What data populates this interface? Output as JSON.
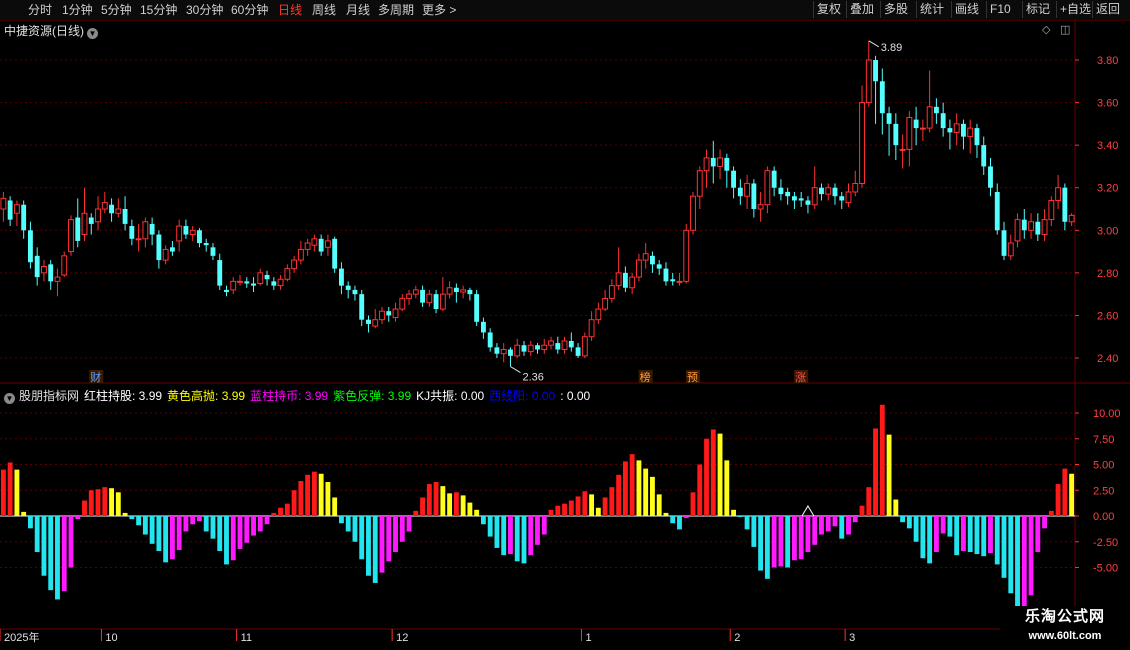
{
  "toolbar": {
    "periods": [
      "分时",
      "1分钟",
      "5分钟",
      "15分钟",
      "30分钟",
      "60分钟",
      "日线",
      "周线",
      "月线",
      "多周期",
      "更多 >"
    ],
    "active_period": "日线",
    "right_buttons": [
      "复权",
      "叠加",
      "多股",
      "统计",
      "画线",
      "F10",
      "标记",
      "+自选",
      "返回"
    ]
  },
  "stock_title": "中捷资源(日线)",
  "indicator": {
    "name": "股朋指标网",
    "items": [
      {
        "label": "红柱持股:",
        "value": "3.99",
        "color": "#ffffff"
      },
      {
        "label": "黄色高抛:",
        "value": "3.99",
        "color": "#ffff00"
      },
      {
        "label": "蓝柱持币:",
        "value": "3.99",
        "color": "#ff00ff"
      },
      {
        "label": "紫色反弹:",
        "value": "3.99",
        "color": "#00ff00"
      },
      {
        "label": "KJ共振:",
        "value": "0.00",
        "color": "#ffffff"
      },
      {
        "label": "西线阳:",
        "value": "0.00",
        "color": "#0000ff"
      },
      {
        "label": ":",
        "value": "0.00",
        "color": "#ffffff"
      }
    ]
  },
  "price_axis": [
    "3.80",
    "3.60",
    "3.40",
    "3.20",
    "3.00",
    "2.80",
    "2.60",
    "2.40"
  ],
  "indicator_axis": [
    "10.00",
    "7.50",
    "5.00",
    "2.50",
    "0.00",
    "-2.50",
    "-5.00"
  ],
  "date_axis": [
    "2025年",
    "10",
    "11",
    "12",
    "1",
    "2",
    "3"
  ],
  "annotations": {
    "high": "3.89",
    "low": "2.36"
  },
  "event_tags": [
    "财",
    "榜",
    "预",
    "涨"
  ],
  "watermark": {
    "title": "乐淘公式网",
    "url": "www.60lt.com"
  },
  "chart_data": {
    "type": "candlestick",
    "candles": [
      [
        3.1,
        3.15,
        3.18,
        3.04
      ],
      [
        3.14,
        3.05,
        3.16,
        3.02
      ],
      [
        3.08,
        3.12,
        3.14,
        3.02
      ],
      [
        3.12,
        3.0,
        3.14,
        2.96
      ],
      [
        3.0,
        2.85,
        3.04,
        2.82
      ],
      [
        2.88,
        2.78,
        2.92,
        2.74
      ],
      [
        2.8,
        2.83,
        2.86,
        2.76
      ],
      [
        2.84,
        2.76,
        2.86,
        2.72
      ],
      [
        2.76,
        2.78,
        2.82,
        2.69
      ],
      [
        2.79,
        2.88,
        2.9,
        2.78
      ],
      [
        2.9,
        3.05,
        3.07,
        2.88
      ],
      [
        3.06,
        2.95,
        3.15,
        2.92
      ],
      [
        2.98,
        3.08,
        3.2,
        2.95
      ],
      [
        3.06,
        3.03,
        3.08,
        2.98
      ],
      [
        3.04,
        3.1,
        3.16,
        3.0
      ],
      [
        3.1,
        3.13,
        3.18,
        3.08
      ],
      [
        3.12,
        3.08,
        3.15,
        3.04
      ],
      [
        3.08,
        3.1,
        3.15,
        3.06
      ],
      [
        3.1,
        3.03,
        3.16,
        3.0
      ],
      [
        3.02,
        2.96,
        3.05,
        2.93
      ],
      [
        2.96,
        2.96,
        3.03,
        2.9
      ],
      [
        2.96,
        3.04,
        3.06,
        2.92
      ],
      [
        3.03,
        2.98,
        3.06,
        2.93
      ],
      [
        2.98,
        2.86,
        3.0,
        2.82
      ],
      [
        2.86,
        2.91,
        2.93,
        2.84
      ],
      [
        2.92,
        2.9,
        2.95,
        2.88
      ],
      [
        2.95,
        3.02,
        3.05,
        2.9
      ],
      [
        3.02,
        2.98,
        3.05,
        2.96
      ],
      [
        2.98,
        3.0,
        3.02,
        2.95
      ],
      [
        3.0,
        2.94,
        3.01,
        2.92
      ],
      [
        2.94,
        2.93,
        2.96,
        2.9
      ],
      [
        2.92,
        2.88,
        2.94,
        2.86
      ],
      [
        2.86,
        2.74,
        2.89,
        2.72
      ],
      [
        2.72,
        2.71,
        2.74,
        2.69
      ],
      [
        2.72,
        2.76,
        2.78,
        2.7
      ],
      [
        2.76,
        2.76,
        2.79,
        2.74
      ],
      [
        2.76,
        2.75,
        2.78,
        2.73
      ],
      [
        2.75,
        2.74,
        2.78,
        2.71
      ],
      [
        2.75,
        2.8,
        2.82,
        2.74
      ],
      [
        2.79,
        2.77,
        2.81,
        2.74
      ],
      [
        2.76,
        2.74,
        2.78,
        2.72
      ],
      [
        2.74,
        2.77,
        2.79,
        2.72
      ],
      [
        2.77,
        2.82,
        2.84,
        2.76
      ],
      [
        2.82,
        2.86,
        2.88,
        2.8
      ],
      [
        2.86,
        2.91,
        2.95,
        2.84
      ],
      [
        2.91,
        2.94,
        2.96,
        2.88
      ],
      [
        2.93,
        2.96,
        2.98,
        2.9
      ],
      [
        2.96,
        2.9,
        2.98,
        2.88
      ],
      [
        2.92,
        2.95,
        2.98,
        2.88
      ],
      [
        2.96,
        2.82,
        2.97,
        2.8
      ],
      [
        2.82,
        2.74,
        2.85,
        2.7
      ],
      [
        2.74,
        2.72,
        2.76,
        2.68
      ],
      [
        2.72,
        2.7,
        2.74,
        2.67
      ],
      [
        2.7,
        2.58,
        2.72,
        2.55
      ],
      [
        2.58,
        2.56,
        2.6,
        2.52
      ],
      [
        2.55,
        2.58,
        2.63,
        2.54
      ],
      [
        2.58,
        2.62,
        2.64,
        2.56
      ],
      [
        2.62,
        2.6,
        2.64,
        2.57
      ],
      [
        2.59,
        2.63,
        2.66,
        2.57
      ],
      [
        2.63,
        2.68,
        2.7,
        2.62
      ],
      [
        2.68,
        2.7,
        2.72,
        2.65
      ],
      [
        2.7,
        2.72,
        2.74,
        2.68
      ],
      [
        2.72,
        2.66,
        2.74,
        2.64
      ],
      [
        2.66,
        2.7,
        2.72,
        2.64
      ],
      [
        2.7,
        2.63,
        2.72,
        2.61
      ],
      [
        2.63,
        2.7,
        2.78,
        2.62
      ],
      [
        2.7,
        2.73,
        2.76,
        2.68
      ],
      [
        2.73,
        2.71,
        2.75,
        2.66
      ],
      [
        2.71,
        2.72,
        2.74,
        2.68
      ],
      [
        2.72,
        2.7,
        2.73,
        2.67
      ],
      [
        2.7,
        2.57,
        2.72,
        2.55
      ],
      [
        2.57,
        2.52,
        2.59,
        2.49
      ],
      [
        2.52,
        2.45,
        2.54,
        2.43
      ],
      [
        2.45,
        2.42,
        2.47,
        2.4
      ],
      [
        2.42,
        2.44,
        2.47,
        2.38
      ],
      [
        2.44,
        2.41,
        2.45,
        2.36
      ],
      [
        2.41,
        2.46,
        2.49,
        2.4
      ],
      [
        2.46,
        2.43,
        2.48,
        2.41
      ],
      [
        2.43,
        2.46,
        2.48,
        2.41
      ],
      [
        2.46,
        2.44,
        2.47,
        2.42
      ],
      [
        2.44,
        2.46,
        2.49,
        2.42
      ],
      [
        2.46,
        2.48,
        2.5,
        2.44
      ],
      [
        2.47,
        2.44,
        2.5,
        2.42
      ],
      [
        2.44,
        2.48,
        2.5,
        2.42
      ],
      [
        2.48,
        2.45,
        2.52,
        2.43
      ],
      [
        2.45,
        2.41,
        2.47,
        2.4
      ],
      [
        2.41,
        2.5,
        2.52,
        2.4
      ],
      [
        2.5,
        2.58,
        2.62,
        2.48
      ],
      [
        2.58,
        2.63,
        2.66,
        2.56
      ],
      [
        2.63,
        2.68,
        2.72,
        2.62
      ],
      [
        2.68,
        2.74,
        2.77,
        2.66
      ],
      [
        2.74,
        2.8,
        2.92,
        2.72
      ],
      [
        2.8,
        2.73,
        2.83,
        2.71
      ],
      [
        2.73,
        2.78,
        2.8,
        2.7
      ],
      [
        2.78,
        2.86,
        2.89,
        2.76
      ],
      [
        2.86,
        2.89,
        2.94,
        2.82
      ],
      [
        2.88,
        2.84,
        2.9,
        2.8
      ],
      [
        2.84,
        2.82,
        2.86,
        2.79
      ],
      [
        2.82,
        2.76,
        2.85,
        2.74
      ],
      [
        2.77,
        2.76,
        2.8,
        2.74
      ],
      [
        2.76,
        2.76,
        2.8,
        2.74
      ],
      [
        2.76,
        3.0,
        3.03,
        2.75
      ],
      [
        3.0,
        3.16,
        3.18,
        2.98
      ],
      [
        3.16,
        3.28,
        3.3,
        3.1
      ],
      [
        3.28,
        3.34,
        3.38,
        3.2
      ],
      [
        3.34,
        3.3,
        3.42,
        3.22
      ],
      [
        3.3,
        3.34,
        3.38,
        3.24
      ],
      [
        3.34,
        3.28,
        3.36,
        3.2
      ],
      [
        3.28,
        3.2,
        3.3,
        3.15
      ],
      [
        3.2,
        3.16,
        3.24,
        3.12
      ],
      [
        3.16,
        3.22,
        3.26,
        3.1
      ],
      [
        3.22,
        3.1,
        3.24,
        3.06
      ],
      [
        3.1,
        3.12,
        3.18,
        3.04
      ],
      [
        3.12,
        3.28,
        3.3,
        3.08
      ],
      [
        3.28,
        3.2,
        3.3,
        3.16
      ],
      [
        3.2,
        3.17,
        3.24,
        3.14
      ],
      [
        3.18,
        3.16,
        3.2,
        3.12
      ],
      [
        3.16,
        3.14,
        3.18,
        3.1
      ],
      [
        3.15,
        3.14,
        3.18,
        3.11
      ],
      [
        3.14,
        3.12,
        3.16,
        3.08
      ],
      [
        3.12,
        3.2,
        3.3,
        3.1
      ],
      [
        3.2,
        3.17,
        3.22,
        3.14
      ],
      [
        3.17,
        3.2,
        3.22,
        3.14
      ],
      [
        3.2,
        3.16,
        3.22,
        3.12
      ],
      [
        3.16,
        3.14,
        3.18,
        3.1
      ],
      [
        3.13,
        3.18,
        3.22,
        3.11
      ],
      [
        3.18,
        3.22,
        3.28,
        3.16
      ],
      [
        3.22,
        3.6,
        3.68,
        3.2
      ],
      [
        3.6,
        3.8,
        3.89,
        3.58
      ],
      [
        3.8,
        3.7,
        3.82,
        3.5
      ],
      [
        3.7,
        3.55,
        3.76,
        3.45
      ],
      [
        3.55,
        3.5,
        3.58,
        3.35
      ],
      [
        3.5,
        3.4,
        3.55,
        3.33
      ],
      [
        3.38,
        3.38,
        3.45,
        3.29
      ],
      [
        3.38,
        3.53,
        3.56,
        3.3
      ],
      [
        3.52,
        3.48,
        3.58,
        3.4
      ],
      [
        3.48,
        3.48,
        3.52,
        3.42
      ],
      [
        3.48,
        3.58,
        3.75,
        3.46
      ],
      [
        3.58,
        3.55,
        3.62,
        3.5
      ],
      [
        3.55,
        3.48,
        3.6,
        3.44
      ],
      [
        3.48,
        3.46,
        3.52,
        3.38
      ],
      [
        3.46,
        3.5,
        3.55,
        3.4
      ],
      [
        3.5,
        3.44,
        3.52,
        3.38
      ],
      [
        3.44,
        3.48,
        3.52,
        3.36
      ],
      [
        3.48,
        3.4,
        3.5,
        3.34
      ],
      [
        3.4,
        3.3,
        3.44,
        3.26
      ],
      [
        3.3,
        3.2,
        3.34,
        3.16
      ],
      [
        3.18,
        3.0,
        3.22,
        2.98
      ],
      [
        3.0,
        2.88,
        3.04,
        2.86
      ],
      [
        2.88,
        2.94,
        2.98,
        2.86
      ],
      [
        2.95,
        3.05,
        3.08,
        2.92
      ],
      [
        3.05,
        3.0,
        3.1,
        2.96
      ],
      [
        3.0,
        3.04,
        3.08,
        2.96
      ],
      [
        3.04,
        2.98,
        3.08,
        2.95
      ],
      [
        2.98,
        3.05,
        3.1,
        2.95
      ],
      [
        3.05,
        3.14,
        3.16,
        3.02
      ],
      [
        3.14,
        3.2,
        3.26,
        3.1
      ],
      [
        3.2,
        3.04,
        3.22,
        3.0
      ],
      [
        3.04,
        3.07,
        3.08,
        3.02
      ]
    ],
    "indicator_values": [
      4.5,
      5.2,
      4.5,
      0.4,
      -1.2,
      -3.5,
      -5.8,
      -7.2,
      -8.1,
      -7.3,
      -5.0,
      -0.3,
      1.5,
      2.5,
      2.6,
      2.8,
      2.7,
      2.3,
      0.3,
      -0.3,
      -0.9,
      -1.8,
      -2.7,
      -3.4,
      -4.5,
      -4.2,
      -3.3,
      -1.5,
      -0.8,
      -0.5,
      -1.5,
      -2.2,
      -3.4,
      -4.7,
      -4.3,
      -3.2,
      -2.6,
      -1.9,
      -1.5,
      -0.8,
      0.3,
      0.8,
      1.2,
      2.5,
      3.4,
      4.0,
      4.3,
      4.1,
      3.3,
      1.8,
      -0.7,
      -1.5,
      -2.5,
      -4.2,
      -5.8,
      -6.5,
      -5.5,
      -4.4,
      -3.5,
      -2.5,
      -1.5,
      0.5,
      1.8,
      3.1,
      3.3,
      2.9,
      2.2,
      2.3,
      2.0,
      1.3,
      0.6,
      -0.8,
      -2.0,
      -3.1,
      -3.8,
      -3.7,
      -4.4,
      -4.6,
      -3.8,
      -2.8,
      -1.8,
      0.6,
      1.0,
      1.2,
      1.5,
      1.9,
      2.4,
      2.1,
      0.8,
      1.8,
      2.8,
      4.0,
      5.3,
      6.0,
      5.4,
      4.6,
      3.8,
      2.1,
      0.3,
      -0.7,
      -1.3,
      -0.2,
      2.3,
      5.0,
      7.5,
      8.4,
      8.0,
      5.4,
      0.6,
      -0.1,
      -1.3,
      -3.0,
      -5.3,
      -6.1,
      -5.0,
      -4.9,
      -5.0,
      -4.3,
      -4.2,
      -3.5,
      -2.8,
      -1.8,
      -1.5,
      -1.0,
      -2.2,
      -1.8,
      -0.6,
      1.0,
      2.8,
      8.5,
      10.8,
      7.9,
      1.6,
      -0.6,
      -1.2,
      -2.5,
      -4.1,
      -4.6,
      -3.5,
      -1.7,
      -2.0,
      -3.8,
      -3.4,
      -3.5,
      -3.7,
      -3.9,
      -3.6,
      -4.7,
      -6.0,
      -7.5,
      -10.2,
      -9.9,
      -7.7,
      -3.5,
      -1.2,
      0.5,
      3.1,
      4.6,
      4.1
    ]
  }
}
